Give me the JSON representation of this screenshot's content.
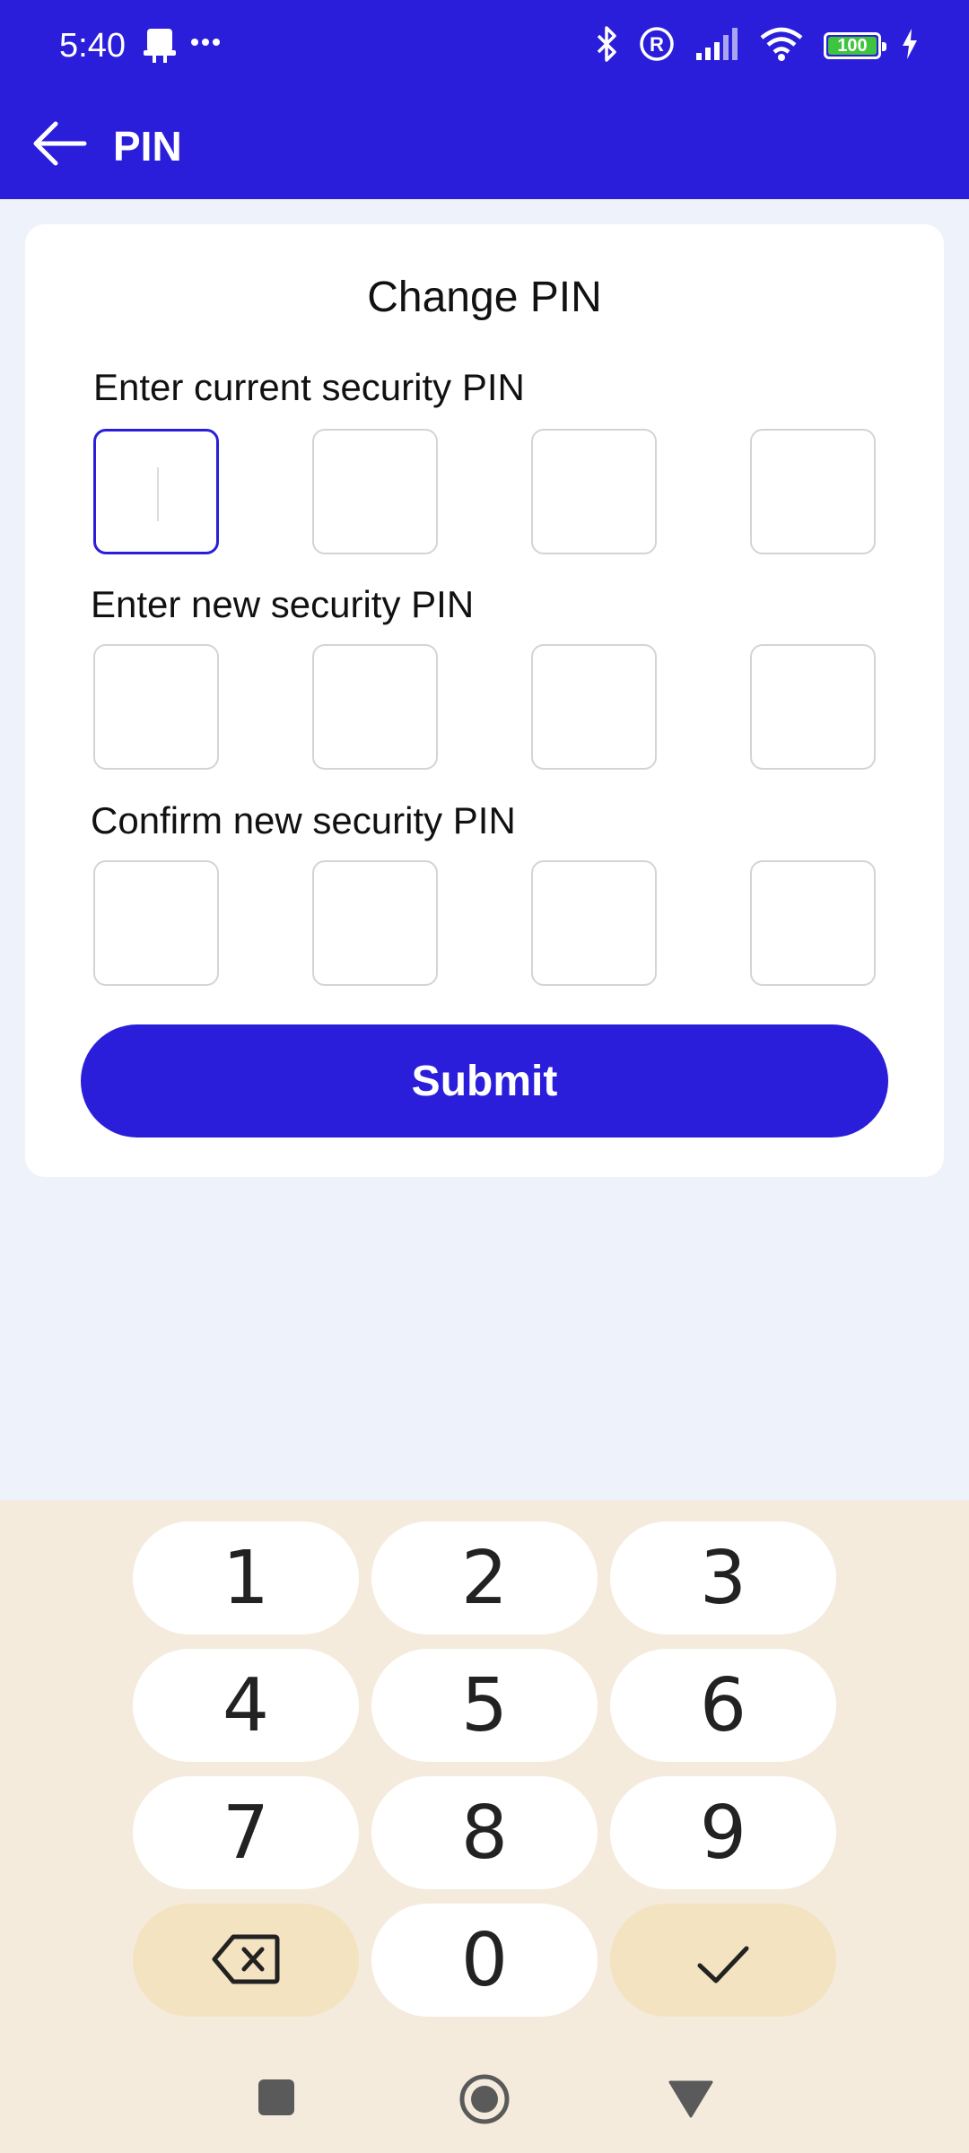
{
  "status_bar": {
    "time": "5:40",
    "left_icons": [
      "notification-icon",
      "more-dots-icon"
    ],
    "right_icons": [
      "bluetooth-icon",
      "registered-icon",
      "signal-icon",
      "wifi-icon",
      "battery-icon",
      "charging-icon"
    ],
    "battery_level": "100"
  },
  "toolbar": {
    "back_icon": "arrow-left-icon",
    "title": "PIN"
  },
  "card": {
    "title": "Change PIN",
    "current_pin_label": "Enter current security PIN",
    "new_pin_label": "Enter new security PIN",
    "confirm_pin_label": "Confirm new security PIN",
    "submit_label": "Submit"
  },
  "keypad": {
    "keys": [
      "1",
      "2",
      "3",
      "4",
      "5",
      "6",
      "7",
      "8",
      "9",
      "0"
    ],
    "backspace_icon": "backspace-icon",
    "confirm_icon": "checkmark-icon"
  },
  "nav_bar": {
    "icons": [
      "recents-square-icon",
      "home-circle-icon",
      "back-triangle-icon"
    ]
  },
  "colors": {
    "accent": "#2a1edb",
    "background": "#eef2fb",
    "keyboard_bg": "#f5ebdd",
    "key_accent": "#f3e3c0"
  }
}
